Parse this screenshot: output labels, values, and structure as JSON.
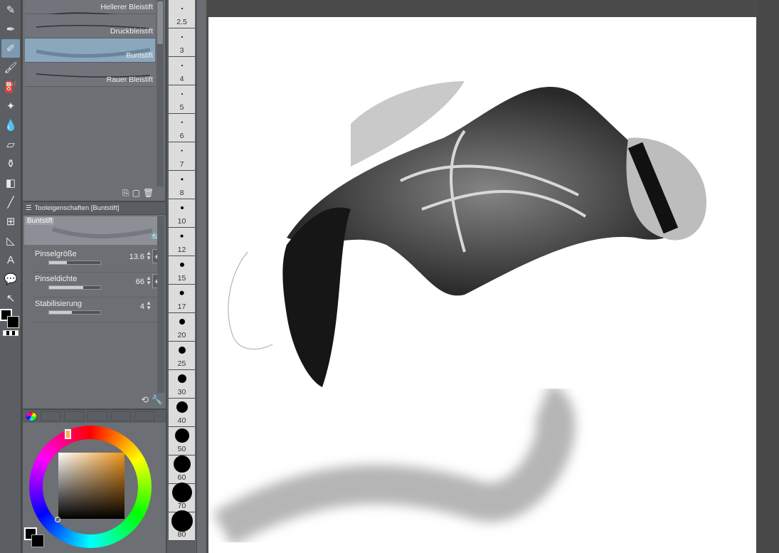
{
  "toolbar": {
    "tools": [
      {
        "name": "eyedropper-icon",
        "glyph": "✎"
      },
      {
        "name": "pen-icon",
        "glyph": "✒"
      },
      {
        "name": "pencil-icon",
        "glyph": "✐",
        "active": true
      },
      {
        "name": "brush-icon",
        "glyph": "🖌"
      },
      {
        "name": "airbrush-icon",
        "glyph": "⛽"
      },
      {
        "name": "decoration-icon",
        "glyph": "✦"
      },
      {
        "name": "blend-icon",
        "glyph": "💧"
      },
      {
        "name": "eraser-icon",
        "glyph": "▱"
      },
      {
        "name": "fill-icon",
        "glyph": "⚱"
      },
      {
        "name": "gradient-icon",
        "glyph": "◧"
      },
      {
        "name": "line-icon",
        "glyph": "╱"
      },
      {
        "name": "frame-icon",
        "glyph": "⊞"
      },
      {
        "name": "ruler-icon",
        "glyph": "◺"
      },
      {
        "name": "text-icon",
        "glyph": "A"
      },
      {
        "name": "balloon-icon",
        "glyph": "💬"
      },
      {
        "name": "correct-line-icon",
        "glyph": "↖"
      }
    ]
  },
  "brushes": {
    "items": [
      {
        "label": "Hellerer Bleistift"
      },
      {
        "label": "Druckbleistift"
      },
      {
        "label": "Buntstift",
        "active": true
      },
      {
        "label": "Rauer Bleistift"
      }
    ],
    "footer_icons": [
      "duplicate-icon",
      "new-icon",
      "trash-icon"
    ]
  },
  "tool_properties": {
    "title": "Tooleigenschaften [Buntstift]",
    "preview_name": "Buntstift",
    "props": [
      {
        "label": "Pinselgröße",
        "value": "13.6",
        "fill": 0.35,
        "lock": true
      },
      {
        "label": "Pinseldichte",
        "value": "66",
        "fill": 0.66,
        "lock": true
      },
      {
        "label": "Stabilisierung",
        "value": "4",
        "fill": 0.45,
        "lock": false
      }
    ]
  },
  "color_panel": {
    "hue_color": "#f0951a"
  },
  "brush_sizes": [
    "2.5",
    "3",
    "4",
    "5",
    "6",
    "7",
    "8",
    "10",
    "12",
    "15",
    "17",
    "20",
    "25",
    "30",
    "40",
    "50",
    "60",
    "70",
    "80"
  ]
}
